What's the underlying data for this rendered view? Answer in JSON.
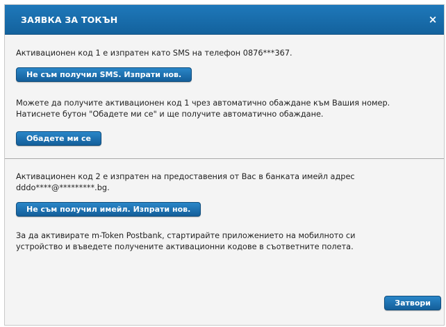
{
  "dialog": {
    "title": "ЗАЯВКА ЗА ТОКЪН",
    "close_icon": "close-icon",
    "close_glyph": "×"
  },
  "sms_section": {
    "message": "Активационен код 1 е изпратен като SMS на телефон 0876***367.",
    "resend_button": "Не съм получил SMS. Изпрати нов."
  },
  "call_section": {
    "message": "Можете да получите активационен код 1 чрез автоматично обаждане към Вашия номер.\nНатиснете бутон \"Обадете ми се\" и ще получите автоматично обаждане.",
    "call_button": "Обадете ми се"
  },
  "email_section": {
    "message": "Активационен код 2 е изпратен на предоставения от Вас в банката имейл адрес\ndddo****@*********.bg.",
    "resend_button": "Не съм получил имейл. Изпрати нов."
  },
  "instructions": {
    "message": "За да активирате m-Token Postbank, стартирайте приложението на мобилното си\nустройство и въведете получените активационни кодове в съответните полета."
  },
  "footer": {
    "close_button": "Затвори"
  },
  "colors": {
    "header": "#1a6fae",
    "button": "#1b6ead",
    "background": "#f4f4f4"
  }
}
